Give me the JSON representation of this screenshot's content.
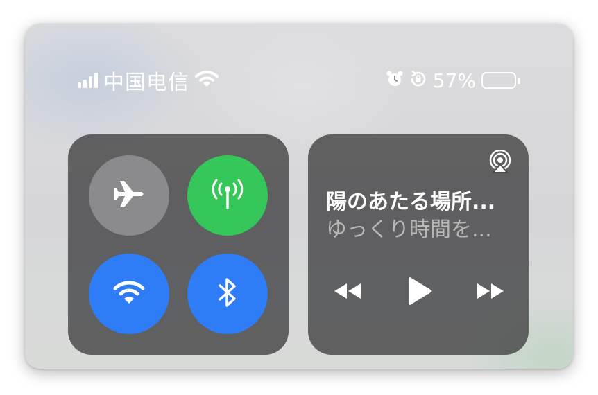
{
  "status_bar": {
    "carrier": "中国电信",
    "battery_percent": "57%",
    "battery_level": 0.57,
    "signal_bars": 4,
    "icons": [
      "signal-icon",
      "wifi-icon",
      "alarm-icon",
      "rotation-lock-icon",
      "battery-icon"
    ]
  },
  "connectivity": {
    "airplane": {
      "icon": "airplane-icon",
      "state": "off",
      "color": "#8b8b8d"
    },
    "cellular": {
      "icon": "cellular-antenna-icon",
      "state": "on",
      "color": "#35c759"
    },
    "wifi": {
      "icon": "wifi-icon",
      "state": "on",
      "color": "#2e7cf6"
    },
    "bluetooth": {
      "icon": "bluetooth-icon",
      "state": "on",
      "color": "#2e7cf6"
    }
  },
  "now_playing": {
    "title": "陽のあたる場所...",
    "subtitle": "ゆっくり時間を...",
    "controls": [
      "rewind-icon",
      "play-icon",
      "fast-forward-icon"
    ],
    "output_icon": "airplay-icon"
  }
}
